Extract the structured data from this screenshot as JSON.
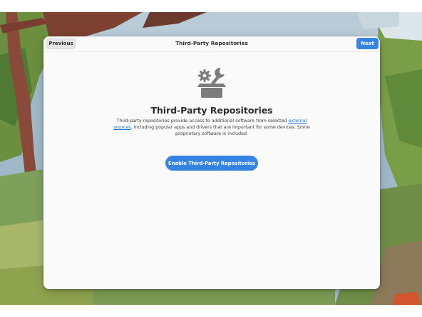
{
  "header": {
    "title": "Third-Party Repositories",
    "previous_label": "Previous",
    "next_label": "Next"
  },
  "content": {
    "icon": "gear-wrench-box-icon",
    "title": "Third-Party Repositories",
    "description_before": "Third-party repositories provide access to additional software from selected ",
    "description_link": "external sources",
    "description_after": ", including popular apps and drivers that are important for some devices. Some proprietary software is included.",
    "enable_label": "Enable Third-Party Repositories"
  },
  "colors": {
    "accent": "#3584e4",
    "link": "#1c71d8",
    "dialog_bg": "#fafafa"
  }
}
